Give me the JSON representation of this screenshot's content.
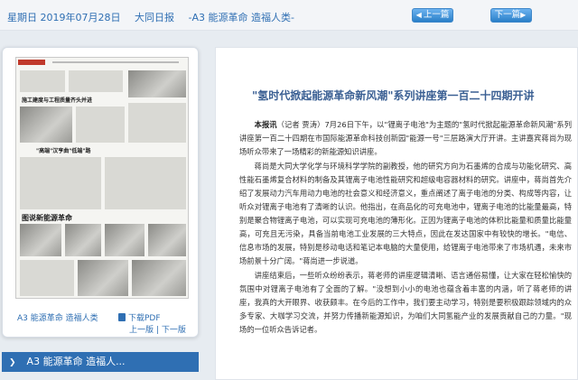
{
  "header": {
    "date": "星期日 2019年07月28日",
    "paper": "大同日报",
    "section": "-A3 能源革命 造福人类-",
    "prev_label": "上一篇",
    "next_label": "下一篇"
  },
  "thumbnail": {
    "section_label": "A3 能源革命 造福人类",
    "pdf_label": "下载PDF",
    "prev_page": "上一版",
    "separator": "|",
    "next_page": "下一版",
    "headline_1": "施工建度与工程质量齐头并进",
    "headline_2": "\"高端\"汉亨曲\"低端\"路",
    "headline_3": "图说新能源革命"
  },
  "sidebar": {
    "active_section": "A3 能源革命 造福人..."
  },
  "article": {
    "title": "\"氢时代掀起能源革命新风潮\"系列讲座第一百二十四期开讲",
    "lead_bold": "本报讯",
    "lead_author": "（记者 贾涛）",
    "p1": "7月26日下午，以\"锂离子电池\"为主题的\"氢时代掀起能源革命新风潮\"系列讲座第一百二十四期在市国际能源革命科技创新园\"能源一号\"三层路演大厅开讲。主讲嘉宾蒋尚为现场听众带来了一场精彩的新能源知识讲座。",
    "p2": "蒋尚是大同大学化学与环境科学学院的副教授，他的研究方向为石墨烯的合成与功能化研究、高性能石墨烯复合材料的制备及其锂离子电池性能研究和超级电容器材料的研究。讲座中，蒋尚首先介绍了发展动力汽车用动力电池的社会意义和经济意义，重点阐述了离子电池的分类、构成等内容，让听众对锂离子电池有了清晰的认识。他指出，在商品化的可充电池中，锂离子电池的比能量最高，特别是聚合物锂离子电池，可以实现可充电池的薄形化。正因为锂离子电池的体积比能量和质量比能量高，可充且无污染，具备当前电池工业发展的三大特点，因此在发达国家中有较快的增长。\"电信、信息市场的发展，特别是移动电话和笔记本电脑的大量使用，给锂离子电池带来了市场机遇，未来市场前景十分广阔。\"蒋尚进一步说道。",
    "p3": "讲座结束后，一些听众纷纷表示，蒋老师的讲座逻辑清晰、语言通俗易懂，让大家在轻松愉快的氛围中对锂离子电池有了全面的了解。\"没想到小小的电池也蕴含着丰富的内涵，听了蒋老师的讲座，我真的大开眼界、收获颇丰。在今后的工作中，我们要主动学习，特别是要积极跟踪领域内的众多专家、大咖学习交流，并努力传播新能源知识，为咱们大同氢能产业的发展贡献自己的力量。\"现场的一位听众告诉记者。"
  }
}
